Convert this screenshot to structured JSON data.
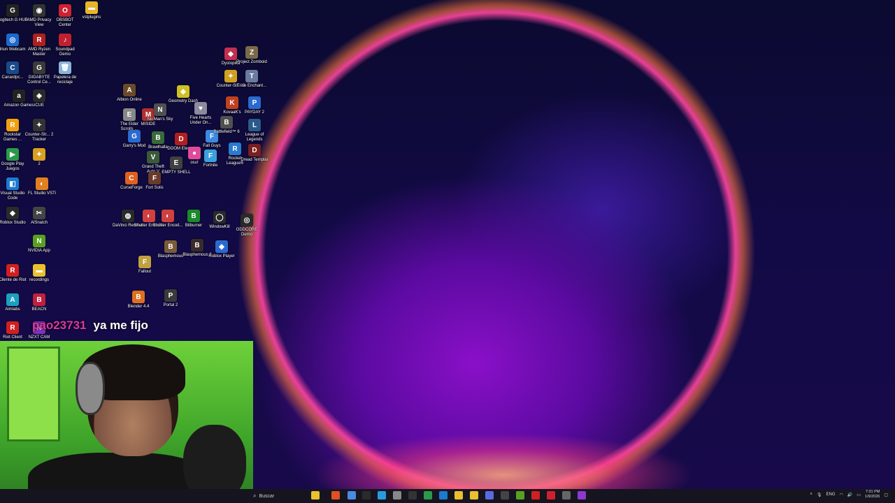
{
  "desktop_icons": [
    {
      "label": "Logitech G HUB",
      "color": "#222222",
      "glyph": "G"
    },
    {
      "label": "AMD Privacy View",
      "color": "#333333",
      "glyph": "◉"
    },
    {
      "label": "OBSBOT Center",
      "color": "#cc2233",
      "glyph": "O"
    },
    {
      "label": "vstplugins",
      "color": "#e8b52a",
      "glyph": "▬"
    },
    {
      "label": "Iriun Webcam",
      "color": "#1b6ad0",
      "glyph": "◎"
    },
    {
      "label": "AMD Ryzen Master",
      "color": "#b02020",
      "glyph": "R"
    },
    {
      "label": "Soundpad Demo",
      "color": "#c02030",
      "glyph": "♪"
    },
    {
      "label": "Canardpc...",
      "color": "#1a4a8a",
      "glyph": "C"
    },
    {
      "label": "GIGABYTE Control Ce...",
      "color": "#3a3a3a",
      "glyph": "G"
    },
    {
      "label": "Papelera de reciclaje",
      "color": "#8ab4d8",
      "glyph": "🗑"
    },
    {
      "label": "Amazon Games",
      "color": "#222222",
      "glyph": "a"
    },
    {
      "label": "iCUE",
      "color": "#2a2a2a",
      "glyph": "◈"
    },
    {
      "label": "Rockstar Games ...",
      "color": "#f0a010",
      "glyph": "R"
    },
    {
      "label": "Counter-Str... 2 Tracker",
      "color": "#333333",
      "glyph": "✦"
    },
    {
      "label": "Google Play Juegos",
      "color": "#2a9a4a",
      "glyph": "▶"
    },
    {
      "label": "2",
      "color": "#d8a020",
      "glyph": "✦"
    },
    {
      "label": "Visual Studio Code",
      "color": "#1a7ad0",
      "glyph": "◧"
    },
    {
      "label": "FL Studio VSTi",
      "color": "#e08020",
      "glyph": "◐"
    },
    {
      "label": "Roblox Studio",
      "color": "#2a2a2a",
      "glyph": "◆"
    },
    {
      "label": "AlSnatch",
      "color": "#444444",
      "glyph": "✂"
    },
    {
      "label": "NVIDIA App",
      "color": "#5aa020",
      "glyph": "N"
    },
    {
      "label": "Cliente de Riot",
      "color": "#d02020",
      "glyph": "R"
    },
    {
      "label": "recordings",
      "color": "#e8c030",
      "glyph": "▬"
    },
    {
      "label": "Aimlabs",
      "color": "#1aa0c0",
      "glyph": "A"
    },
    {
      "label": "BEACN",
      "color": "#c02040",
      "glyph": "B"
    },
    {
      "label": "Riot Client",
      "color": "#d02020",
      "glyph": "R"
    },
    {
      "label": "NZXT CAM",
      "color": "#8030c0",
      "glyph": "N"
    },
    {
      "label": "Albion Online",
      "color": "#6a4a2a",
      "glyph": "A"
    },
    {
      "label": "The Elder Scrolls ...",
      "color": "#888888",
      "glyph": "E"
    },
    {
      "label": "MISIDE",
      "color": "#b03030",
      "glyph": "M"
    },
    {
      "label": "No Man's Sky",
      "color": "#505050",
      "glyph": "N"
    },
    {
      "label": "Geometry Dash",
      "color": "#d0c020",
      "glyph": "◆"
    },
    {
      "label": "Five Hearts Under On...",
      "color": "#8a8aa0",
      "glyph": "♥"
    },
    {
      "label": "Garry's Mod",
      "color": "#2a6ad0",
      "glyph": "G"
    },
    {
      "label": "Brawlhalla",
      "color": "#3a6a3a",
      "glyph": "B"
    },
    {
      "label": "DOOM Eternal",
      "color": "#b02020",
      "glyph": "D"
    },
    {
      "label": "Fall Guys",
      "color": "#3a8ae0",
      "glyph": "F"
    },
    {
      "label": "Grand Theft Auto V",
      "color": "#3a5a3a",
      "glyph": "V"
    },
    {
      "label": "EMPTY SHELL",
      "color": "#404040",
      "glyph": "E"
    },
    {
      "label": "osu!",
      "color": "#e04a9a",
      "glyph": "●"
    },
    {
      "label": "Fortnite",
      "color": "#3aa0e0",
      "glyph": "F"
    },
    {
      "label": "CurseForge",
      "color": "#e06020",
      "glyph": "C"
    },
    {
      "label": "Fort Solis",
      "color": "#6a3a2a",
      "glyph": "F"
    },
    {
      "label": "Dystopika",
      "color": "#c03050",
      "glyph": "◆"
    },
    {
      "label": "Project Zomboid",
      "color": "#7a6a4a",
      "glyph": "Z"
    },
    {
      "label": "Counter-Str... 2",
      "color": "#d0a020",
      "glyph": "✦"
    },
    {
      "label": "Trine Enchant...",
      "color": "#6a7aa0",
      "glyph": "T"
    },
    {
      "label": "KovaaK's",
      "color": "#c04020",
      "glyph": "K"
    },
    {
      "label": "PAYDAY 2",
      "color": "#2a6ad0",
      "glyph": "P"
    },
    {
      "label": "Battlefield™ 6",
      "color": "#505050",
      "glyph": "B"
    },
    {
      "label": "League of Legends",
      "color": "#2a5a8a",
      "glyph": "L"
    },
    {
      "label": "Rocket League®",
      "color": "#2a7ad0",
      "glyph": "R"
    },
    {
      "label": "Dread Templar",
      "color": "#7a2020",
      "glyph": "D"
    },
    {
      "label": "DaVinci Resolve",
      "color": "#2a2a2a",
      "glyph": "◍"
    },
    {
      "label": "Shutter Encoder",
      "color": "#d04040",
      "glyph": "◐"
    },
    {
      "label": "Shutter Encod...",
      "color": "#d04040",
      "glyph": "◐"
    },
    {
      "label": "Bitburner",
      "color": "#1a8a2a",
      "glyph": "B"
    },
    {
      "label": "WindowKill",
      "color": "#2a2a2a",
      "glyph": "◯"
    },
    {
      "label": "ODDCORE Demo",
      "color": "#2a2a2a",
      "glyph": "◎"
    },
    {
      "label": "Blasphemous",
      "color": "#7a5a3a",
      "glyph": "B"
    },
    {
      "label": "Blasphemous 2",
      "color": "#3a2a2a",
      "glyph": "B"
    },
    {
      "label": "Roblox Player",
      "color": "#2a6ad0",
      "glyph": "◆"
    },
    {
      "label": "Fallout",
      "color": "#c0a040",
      "glyph": "F"
    },
    {
      "label": "Blender 4.4",
      "color": "#e07020",
      "glyph": "B"
    },
    {
      "label": "Portal 2",
      "color": "#3a3a3a",
      "glyph": "P"
    }
  ],
  "chat": {
    "username": "pao23731",
    "message": "ya me fijo"
  },
  "taskbar": {
    "search_placeholder": "Buscar",
    "apps": [
      "file-explorer",
      "brave",
      "chrome",
      "steam",
      "edge",
      "settings",
      "terminal",
      "spotify",
      "vscode",
      "explorer",
      "notes",
      "discord",
      "obs",
      "nvidia",
      "riot",
      "opera",
      "chatgpt",
      "obs-studio"
    ]
  },
  "tray": {
    "language": "ENG",
    "time": "7:31 PM",
    "date": "1/9/2026"
  },
  "colors": {
    "chat_user": "#d93a9a",
    "taskbar_bg": "#16151f",
    "webcam_green": "#6ed13a"
  }
}
